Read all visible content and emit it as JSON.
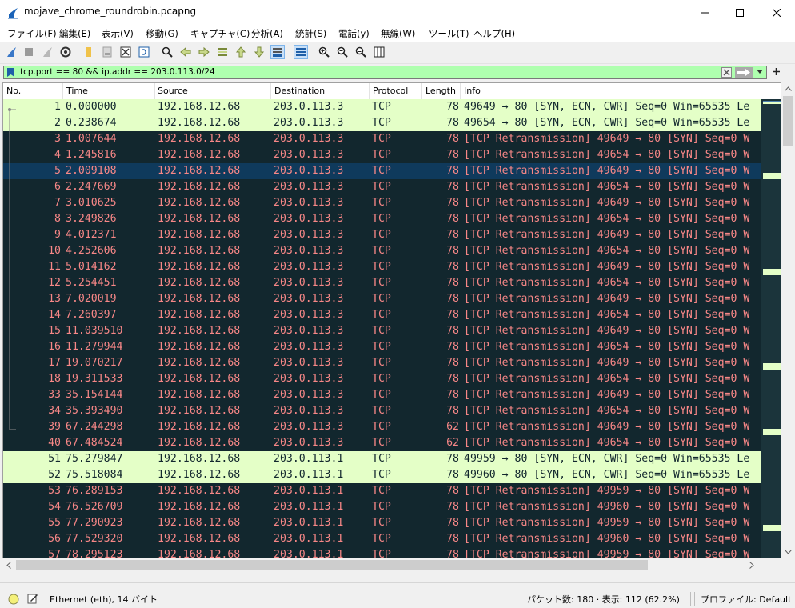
{
  "window": {
    "title": "mojave_chrome_roundrobin.pcapng"
  },
  "menu": [
    "ファイル(F)",
    "編集(E)",
    "表示(V)",
    "移動(G)",
    "キャプチャ(C)",
    "分析(A)",
    "統計(S)",
    "電話(y)",
    "無線(W)",
    "ツール(T)",
    "ヘルプ(H)"
  ],
  "filter": {
    "value": "tcp.port == 80 && ip.addr == 203.0.113.0/24"
  },
  "columns": {
    "no": "No.",
    "time": "Time",
    "source": "Source",
    "destination": "Destination",
    "protocol": "Protocol",
    "length": "Length",
    "info": "Info"
  },
  "packets": [
    {
      "no": "1",
      "time": "0.000000",
      "src": "192.168.12.68",
      "dst": "203.0.113.3",
      "proto": "TCP",
      "len": "78",
      "info": "49649 → 80 [SYN, ECN, CWR] Seq=0 Win=65535 Le",
      "style": "syn"
    },
    {
      "no": "2",
      "time": "0.238674",
      "src": "192.168.12.68",
      "dst": "203.0.113.3",
      "proto": "TCP",
      "len": "78",
      "info": "49654 → 80 [SYN, ECN, CWR] Seq=0 Win=65535 Le",
      "style": "syn"
    },
    {
      "no": "3",
      "time": "1.007644",
      "src": "192.168.12.68",
      "dst": "203.0.113.3",
      "proto": "TCP",
      "len": "78",
      "info": "[TCP Retransmission] 49649 → 80 [SYN] Seq=0 W",
      "style": "bad"
    },
    {
      "no": "4",
      "time": "1.245816",
      "src": "192.168.12.68",
      "dst": "203.0.113.3",
      "proto": "TCP",
      "len": "78",
      "info": "[TCP Retransmission] 49654 → 80 [SYN] Seq=0 W",
      "style": "bad"
    },
    {
      "no": "5",
      "time": "2.009108",
      "src": "192.168.12.68",
      "dst": "203.0.113.3",
      "proto": "TCP",
      "len": "78",
      "info": "[TCP Retransmission] 49649 → 80 [SYN] Seq=0 W",
      "style": "cur"
    },
    {
      "no": "6",
      "time": "2.247669",
      "src": "192.168.12.68",
      "dst": "203.0.113.3",
      "proto": "TCP",
      "len": "78",
      "info": "[TCP Retransmission] 49654 → 80 [SYN] Seq=0 W",
      "style": "bad"
    },
    {
      "no": "7",
      "time": "3.010625",
      "src": "192.168.12.68",
      "dst": "203.0.113.3",
      "proto": "TCP",
      "len": "78",
      "info": "[TCP Retransmission] 49649 → 80 [SYN] Seq=0 W",
      "style": "bad"
    },
    {
      "no": "8",
      "time": "3.249826",
      "src": "192.168.12.68",
      "dst": "203.0.113.3",
      "proto": "TCP",
      "len": "78",
      "info": "[TCP Retransmission] 49654 → 80 [SYN] Seq=0 W",
      "style": "bad"
    },
    {
      "no": "9",
      "time": "4.012371",
      "src": "192.168.12.68",
      "dst": "203.0.113.3",
      "proto": "TCP",
      "len": "78",
      "info": "[TCP Retransmission] 49649 → 80 [SYN] Seq=0 W",
      "style": "bad"
    },
    {
      "no": "10",
      "time": "4.252606",
      "src": "192.168.12.68",
      "dst": "203.0.113.3",
      "proto": "TCP",
      "len": "78",
      "info": "[TCP Retransmission] 49654 → 80 [SYN] Seq=0 W",
      "style": "bad"
    },
    {
      "no": "11",
      "time": "5.014162",
      "src": "192.168.12.68",
      "dst": "203.0.113.3",
      "proto": "TCP",
      "len": "78",
      "info": "[TCP Retransmission] 49649 → 80 [SYN] Seq=0 W",
      "style": "bad"
    },
    {
      "no": "12",
      "time": "5.254451",
      "src": "192.168.12.68",
      "dst": "203.0.113.3",
      "proto": "TCP",
      "len": "78",
      "info": "[TCP Retransmission] 49654 → 80 [SYN] Seq=0 W",
      "style": "bad"
    },
    {
      "no": "13",
      "time": "7.020019",
      "src": "192.168.12.68",
      "dst": "203.0.113.3",
      "proto": "TCP",
      "len": "78",
      "info": "[TCP Retransmission] 49649 → 80 [SYN] Seq=0 W",
      "style": "bad"
    },
    {
      "no": "14",
      "time": "7.260397",
      "src": "192.168.12.68",
      "dst": "203.0.113.3",
      "proto": "TCP",
      "len": "78",
      "info": "[TCP Retransmission] 49654 → 80 [SYN] Seq=0 W",
      "style": "bad"
    },
    {
      "no": "15",
      "time": "11.039510",
      "src": "192.168.12.68",
      "dst": "203.0.113.3",
      "proto": "TCP",
      "len": "78",
      "info": "[TCP Retransmission] 49649 → 80 [SYN] Seq=0 W",
      "style": "bad"
    },
    {
      "no": "16",
      "time": "11.279944",
      "src": "192.168.12.68",
      "dst": "203.0.113.3",
      "proto": "TCP",
      "len": "78",
      "info": "[TCP Retransmission] 49654 → 80 [SYN] Seq=0 W",
      "style": "bad"
    },
    {
      "no": "17",
      "time": "19.070217",
      "src": "192.168.12.68",
      "dst": "203.0.113.3",
      "proto": "TCP",
      "len": "78",
      "info": "[TCP Retransmission] 49649 → 80 [SYN] Seq=0 W",
      "style": "bad"
    },
    {
      "no": "18",
      "time": "19.311533",
      "src": "192.168.12.68",
      "dst": "203.0.113.3",
      "proto": "TCP",
      "len": "78",
      "info": "[TCP Retransmission] 49654 → 80 [SYN] Seq=0 W",
      "style": "bad"
    },
    {
      "no": "33",
      "time": "35.154144",
      "src": "192.168.12.68",
      "dst": "203.0.113.3",
      "proto": "TCP",
      "len": "78",
      "info": "[TCP Retransmission] 49649 → 80 [SYN] Seq=0 W",
      "style": "bad"
    },
    {
      "no": "34",
      "time": "35.393490",
      "src": "192.168.12.68",
      "dst": "203.0.113.3",
      "proto": "TCP",
      "len": "78",
      "info": "[TCP Retransmission] 49654 → 80 [SYN] Seq=0 W",
      "style": "bad"
    },
    {
      "no": "39",
      "time": "67.244298",
      "src": "192.168.12.68",
      "dst": "203.0.113.3",
      "proto": "TCP",
      "len": "62",
      "info": "[TCP Retransmission] 49649 → 80 [SYN] Seq=0 W",
      "style": "bad"
    },
    {
      "no": "40",
      "time": "67.484524",
      "src": "192.168.12.68",
      "dst": "203.0.113.3",
      "proto": "TCP",
      "len": "62",
      "info": "[TCP Retransmission] 49654 → 80 [SYN] Seq=0 W",
      "style": "bad"
    },
    {
      "no": "51",
      "time": "75.279847",
      "src": "192.168.12.68",
      "dst": "203.0.113.1",
      "proto": "TCP",
      "len": "78",
      "info": "49959 → 80 [SYN, ECN, CWR] Seq=0 Win=65535 Le",
      "style": "syn"
    },
    {
      "no": "52",
      "time": "75.518084",
      "src": "192.168.12.68",
      "dst": "203.0.113.1",
      "proto": "TCP",
      "len": "78",
      "info": "49960 → 80 [SYN, ECN, CWR] Seq=0 Win=65535 Le",
      "style": "syn"
    },
    {
      "no": "53",
      "time": "76.289153",
      "src": "192.168.12.68",
      "dst": "203.0.113.1",
      "proto": "TCP",
      "len": "78",
      "info": "[TCP Retransmission] 49959 → 80 [SYN] Seq=0 W",
      "style": "bad"
    },
    {
      "no": "54",
      "time": "76.526709",
      "src": "192.168.12.68",
      "dst": "203.0.113.1",
      "proto": "TCP",
      "len": "78",
      "info": "[TCP Retransmission] 49960 → 80 [SYN] Seq=0 W",
      "style": "bad"
    },
    {
      "no": "55",
      "time": "77.290923",
      "src": "192.168.12.68",
      "dst": "203.0.113.1",
      "proto": "TCP",
      "len": "78",
      "info": "[TCP Retransmission] 49959 → 80 [SYN] Seq=0 W",
      "style": "bad"
    },
    {
      "no": "56",
      "time": "77.529320",
      "src": "192.168.12.68",
      "dst": "203.0.113.1",
      "proto": "TCP",
      "len": "78",
      "info": "[TCP Retransmission] 49960 → 80 [SYN] Seq=0 W",
      "style": "bad"
    },
    {
      "no": "57",
      "time": "78.295123",
      "src": "192.168.12.68",
      "dst": "203.0.113.1",
      "proto": "TCP",
      "len": "78",
      "info": "[TCP Retransmission] 49959 → 80 [SYN] Seq=0 W",
      "style": "bad"
    }
  ],
  "status": {
    "interface": "Ethernet (eth), 14 バイト",
    "packets": "パケット数: 180 · 表示: 112 (62.2%)",
    "profile": "プロファイル: Default"
  },
  "colors": {
    "syn_bg": "#e4ffc7",
    "bad_bg": "#12272e",
    "bad_fg": "#f78787",
    "selected_bg": "#0f3a5c",
    "filter_ok": "#afffaf"
  }
}
